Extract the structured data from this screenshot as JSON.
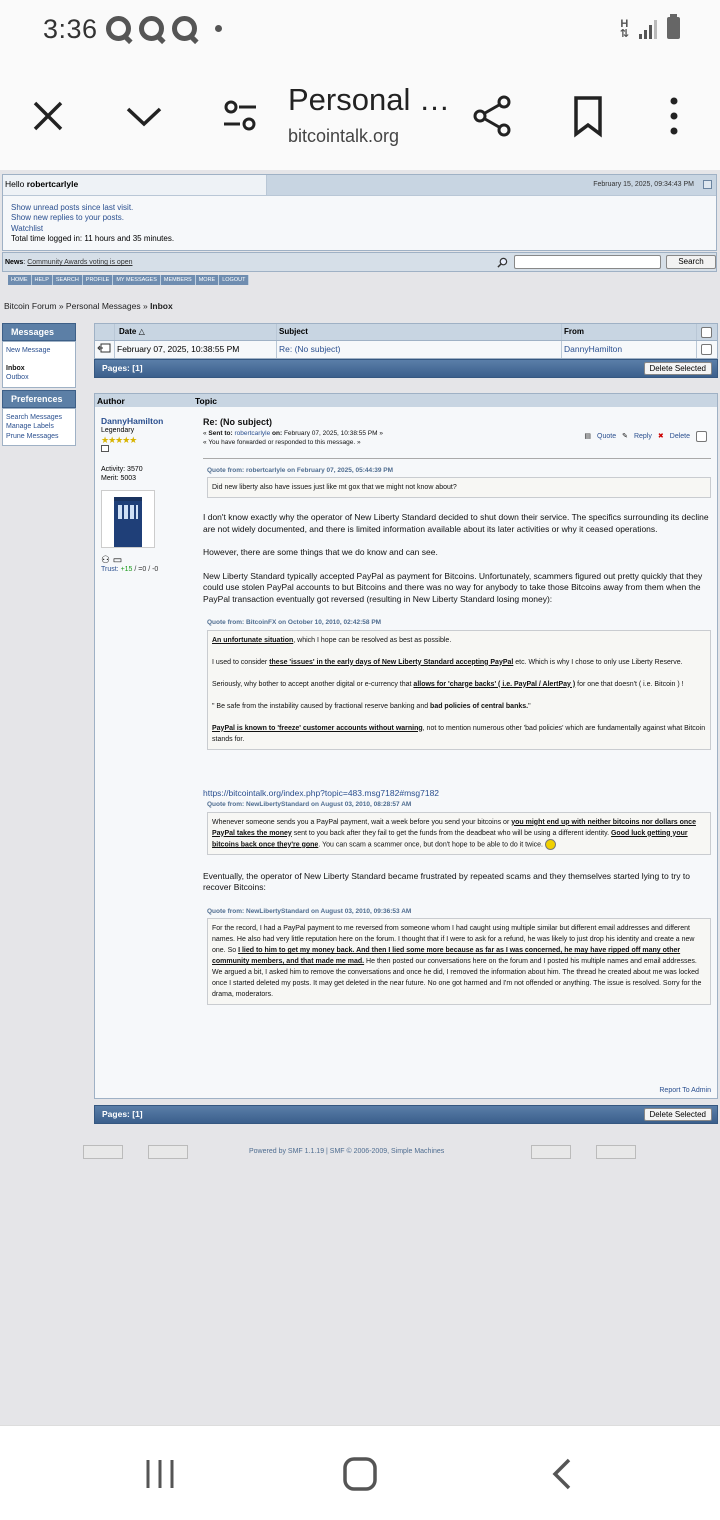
{
  "status_bar": {
    "time": "3:36"
  },
  "browser": {
    "title": "Personal …",
    "domain": "bitcointalk.org"
  },
  "forum": {
    "hello_prefix": "Hello ",
    "username": "robertcarlyle",
    "datetime": "February 15, 2025, 09:34:43 PM",
    "links": [
      "Show unread posts since last visit.",
      "Show new replies to your posts.",
      "Watchlist"
    ],
    "time_logged": "Total time logged in: 11 hours and 35 minutes.",
    "news_label": "News",
    "news_text": "Community Awards voting is open",
    "search_label": "Search",
    "menu": [
      "HOME",
      "HELP",
      "SEARCH",
      "PROFILE",
      "MY MESSAGES",
      "MEMBERS",
      "MORE",
      "LOGOUT"
    ],
    "breadcrumb": {
      "root": "Bitcoin Forum",
      "pm": "Personal Messages",
      "current": "Inbox",
      "sep": "»"
    }
  },
  "sidebar": {
    "messages_title": "Messages",
    "messages_items": [
      "New Message",
      "Inbox",
      "Outbox"
    ],
    "preferences_title": "Preferences",
    "preferences_items": [
      "Search Messages",
      "Manage Labels",
      "Prune Messages"
    ]
  },
  "pm_list": {
    "headers": {
      "date": "Date",
      "subject": "Subject",
      "from": "From"
    },
    "row": {
      "date": "February 07, 2025, 10:38:55 PM",
      "subject": "Re: (No subject)",
      "from": "DannyHamilton"
    },
    "pages": "Pages: [1]",
    "delete_selected": "Delete Selected"
  },
  "message": {
    "headers": {
      "author": "Author",
      "topic": "Topic"
    },
    "poster": {
      "name": "DannyHamilton",
      "rank": "Legendary",
      "activity": "Activity: 3570",
      "merit": "Merit: 5003",
      "trust_label": "Trust: ",
      "trust_pos": "+15",
      "trust_rest": " / =0 / -0"
    },
    "subject": "Re: (No subject)",
    "sent_to_label": "Sent to:",
    "sent_to": "robertcarlyle",
    "on_label": "on:",
    "sent_on": "February 07, 2025, 10:38:55 PM",
    "forwarded": "You have forwarded or responded to this message.",
    "actions": {
      "quote": "Quote",
      "reply": "Reply",
      "delete": "Delete"
    },
    "quote1_head": "Quote from: robertcarlyle on February 07, 2025, 05:44:39 PM",
    "quote1_body": "Did new liberty also have issues just like mt gox that we might not know about?",
    "p1": "I don't know exactly why the operator of New Liberty Standard decided to shut down their service. The specifics surrounding its decline are not widely documented, and there is limited information available about its later activities or why it ceased operations.",
    "p2": "However, there are some things that we do know and can see.",
    "p3": "New Liberty Standard typically accepted PayPal as payment for Bitcoins.  Unfortunately, scammers figured out pretty quickly that they could use stolen PayPal accounts to but Bitcoins and there was no way for anybody to take those Bitcoins away from them when the PayPal transaction eventually got reversed (resulting in New Liberty Standard losing money):",
    "quote2_head": "Quote from: BitcoinFX on October 10, 2010, 02:42:58 PM",
    "quote2": {
      "l1_b": "An unfortunate situation",
      "l1": ", which I hope can be resolved as best as possible.",
      "l2_a": "I used to consider ",
      "l2_b": "these 'issues' in the early days of New Liberty Standard accepting PayPal",
      "l2_c": " etc. Which is why I chose to only use Liberty Reserve.",
      "l3_a": "Seriously, why bother to accept another digital or e-currency that ",
      "l3_b": "allows for 'charge backs' ( i.e. PayPal / AlertPay )",
      "l3_c": " for one that doesn't ( i.e. Bitcoin ) !",
      "l4_a": "\" Be safe from the instability caused by fractional reserve banking and ",
      "l4_b": "bad policies of central banks.",
      "l4_c": "\"",
      "l5_b": "PayPal is known to 'freeze' customer accounts without warning",
      "l5_c": ", not to mention numerous other 'bad policies' which are fundamentally against what Bitcoin stands for."
    },
    "url": "https://bitcointalk.org/index.php?topic=483.msg7182#msg7182",
    "quote3_head": "Quote from: NewLibertyStandard on August 03, 2010, 08:28:57 AM",
    "quote3": {
      "a": "Whenever someone sends you a PayPal payment, wait a week before you send your bitcoins or ",
      "b": "you might end up with neither bitcoins nor dollars once PayPal takes the money",
      "c": " sent to you back after they fail to get the funds from the deadbeat who will be using a different identity. ",
      "d": "Good luck getting your bitcoins back once they're gone",
      "e": ". You can scam a scammer once, but don't hope to be able to do it twice. "
    },
    "p4": "Eventually, the operator of New Liberty Standard became frustrated by repeated scams and they themselves started lying to try to recover Bitcoins:",
    "quote4_head": "Quote from: NewLibertyStandard on August 03, 2010, 09:36:53 AM",
    "quote4": {
      "a": "For the record, I had a PayPal payment to me reversed from someone whom I had caught using multiple similar but different email addresses and different names. He also had very little reputation here on the forum. I thought that if I were to ask for a refund, he was likely to just drop his identity and create a new one. So ",
      "b": "I lied to him to get my money back. And then I lied some more because as far as I was concerned, he may have ripped off many other community members, and that made me mad.",
      "c": " He then posted our conversations here on the forum and I posted his multiple names and email addresses. We argued a bit, I asked him to remove the conversations and once he did, I removed the information about him. The thread he created about me was locked once I started deleted my posts. It may get deleted in the near future. No one got harmed and I'm not offended or anything. The issue is resolved. Sorry for the drama, moderators."
    },
    "report": "Report To Admin"
  },
  "footer": {
    "powered": "Powered by SMF 1.1.19 | SMF © 2006-2009, Simple Machines"
  }
}
